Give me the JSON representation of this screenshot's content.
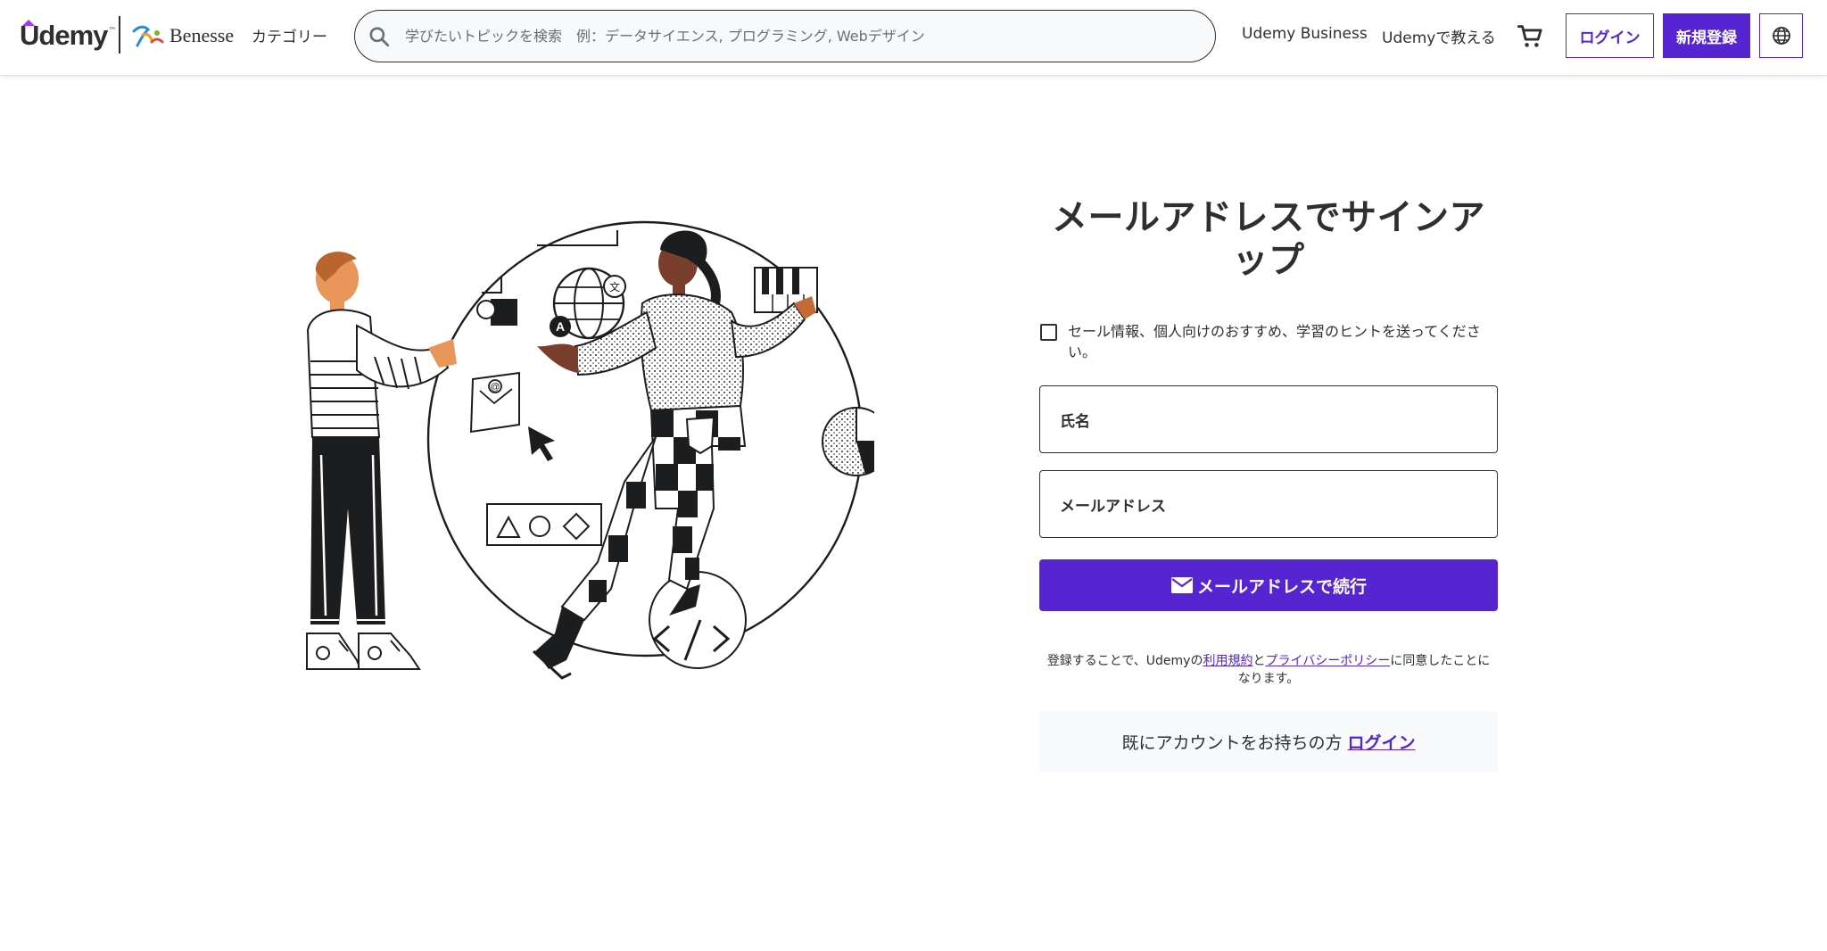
{
  "header": {
    "brand": "Udemy",
    "partner": "Benesse",
    "categories": "カテゴリー",
    "search_placeholder": "学びたいトピックを検索　例：データサイエンス, プログラミング, Webデザイン",
    "business_link": "Udemy Business",
    "teach_link": "Udemyで教える",
    "login_button": "ログイン",
    "signup_button": "新規登録",
    "icons": {
      "search": "search-icon",
      "cart": "cart-icon",
      "language": "globe-icon"
    }
  },
  "signup": {
    "title": "メールアドレスでサインアップ",
    "optin_label": "セール情報、個人向けのおすすめ、学習のヒントを送ってください。",
    "name_label": "氏名",
    "email_label": "メールアドレス",
    "continue_button": "メールアドレスで続行",
    "terms": {
      "prefix": "登録することで、Udemyの",
      "terms_link": "利用規約",
      "and": "と",
      "privacy_link": "プライバシーポリシー",
      "suffix": "に同意したことになります。"
    },
    "have_account": "既にアカウントをお持ちの方",
    "login_link": "ログイン"
  },
  "colors": {
    "accent": "#5624d0",
    "text": "#2d2f31",
    "muted_bg": "#f7f9fa"
  }
}
